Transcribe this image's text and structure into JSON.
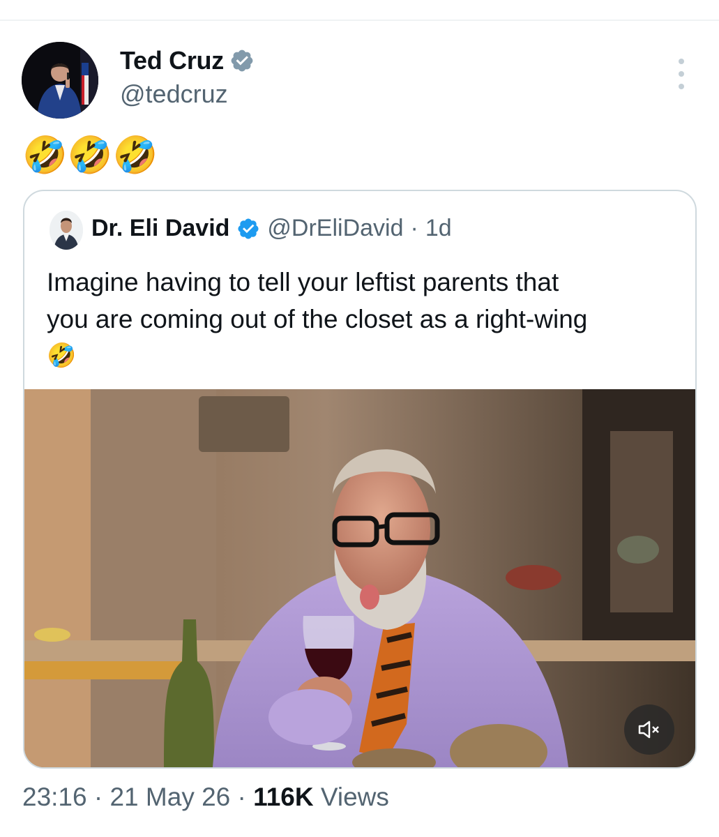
{
  "tweet": {
    "author": {
      "name": "Ted Cruz",
      "handle": "@tedcruz",
      "verified_color": "#829aab"
    },
    "text": "🤣🤣🤣",
    "quoted": {
      "author": {
        "name": "Dr. Eli David",
        "handle": "@DrEliDavid",
        "verified_color": "#1d9bf0"
      },
      "separator": "·",
      "time": "1d",
      "text_line1": "Imagine having to tell your leftist parents that",
      "text_line2": "you are coming out of the closet as a right-wing",
      "text_line3": "🤣",
      "media": {
        "type": "video",
        "muted": true
      }
    },
    "meta": {
      "time": "23:16",
      "sep1": "·",
      "date": "21 May 26",
      "sep2": "·",
      "views_count": "116K",
      "views_label": "Views"
    }
  },
  "icons": {
    "more": "more-vertical-icon",
    "verified": "verified-badge-icon",
    "mute": "speaker-muted-icon"
  }
}
